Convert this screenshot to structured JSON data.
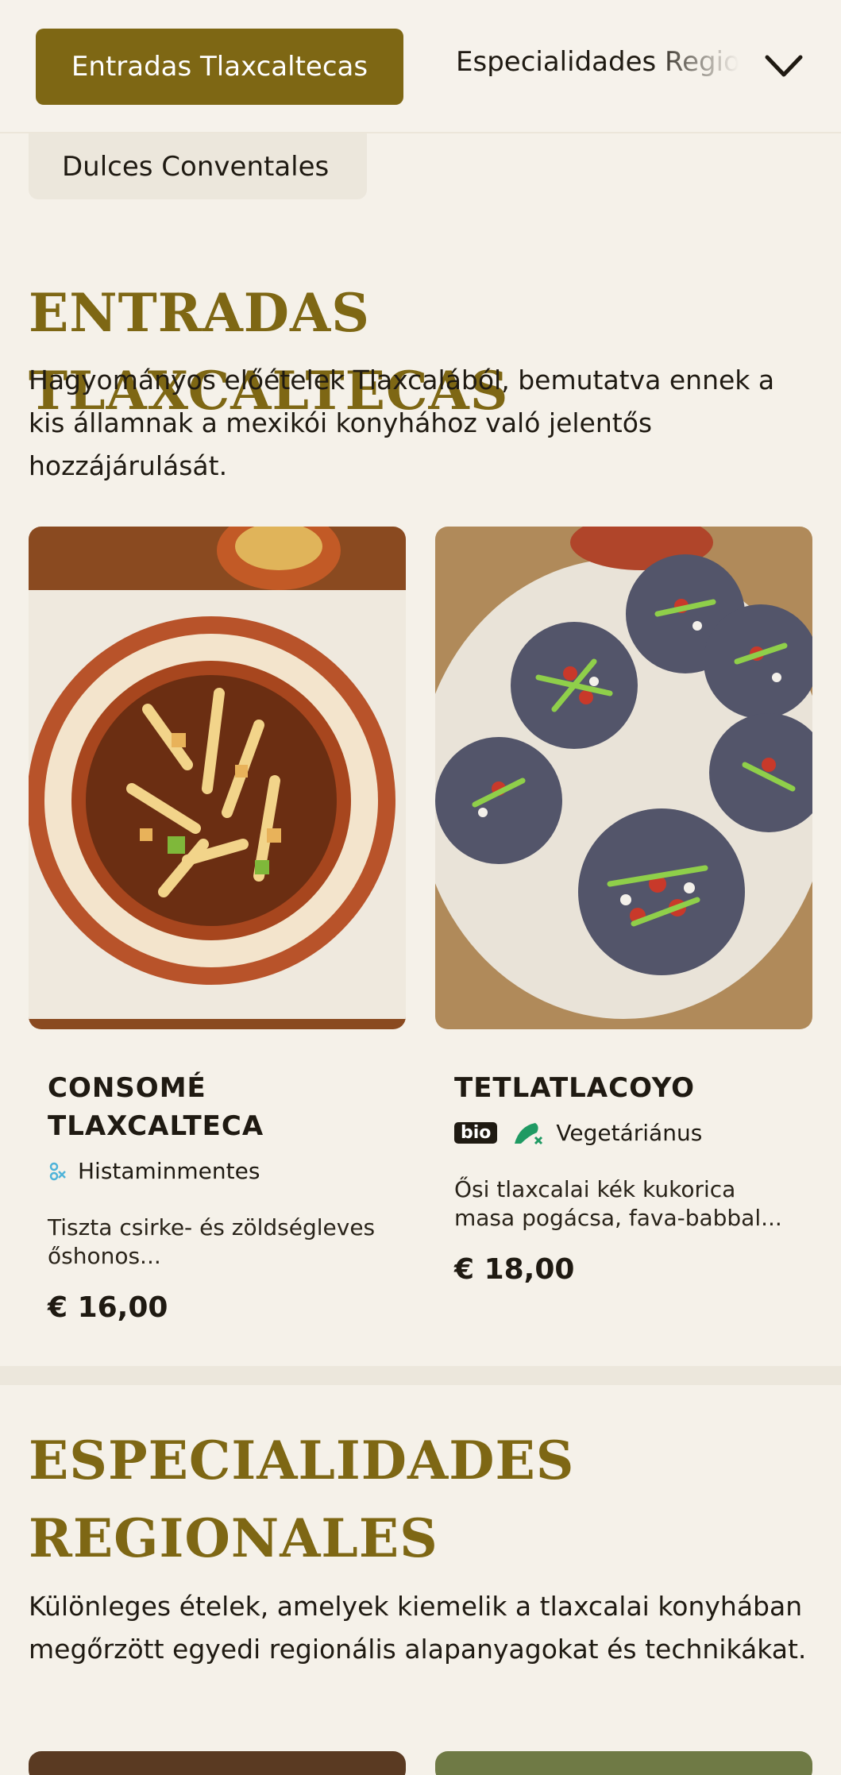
{
  "nav": {
    "active_label": "Entradas Tlaxcaltecas",
    "next_label": "Especialidades Regionales",
    "chip_label": "Dulces Conventales"
  },
  "sections": [
    {
      "title": "ENTRADAS TLAXCALTECAS",
      "description": "Hagyományos előételek Tlaxcalából, bemutatva ennek a kis államnak a mexikói konyhához való jelentős hozzájárulását.",
      "items": [
        {
          "name": "CONSOMÉ TLAXCALTECA",
          "tags": [
            "Histaminmentes"
          ],
          "description": "Tiszta csirke- és zöldségleves őshonos...",
          "price": "€ 16,00",
          "image": "tortilla soup in decorated clay bowl"
        },
        {
          "name": "TETLATLACOYO",
          "badge": "bio",
          "tags": [
            "Vegetáriánus"
          ],
          "description": "Ősi tlaxcalai kék kukorica masa pogácsa, fava-babbal...",
          "price": "€ 18,00",
          "image": "blue corn tlacoyos with nopal strips and cheese"
        }
      ]
    },
    {
      "title": "ESPECIALIDADES REGIONALES",
      "description": "Különleges ételek, amelyek kiemelik a tlaxcalai konyhában megőrzött egyedi regionális alapanyagokat és technikákat."
    }
  ],
  "colors": {
    "accent": "#7e6714",
    "background": "#f5f1e9",
    "chip": "#ece7dc",
    "histamine_icon": "#4fb3d9",
    "vegetarian_icon": "#1f9a63"
  },
  "icons": [
    "chevron-down-icon",
    "histamine-free-icon",
    "vegetarian-icon"
  ]
}
